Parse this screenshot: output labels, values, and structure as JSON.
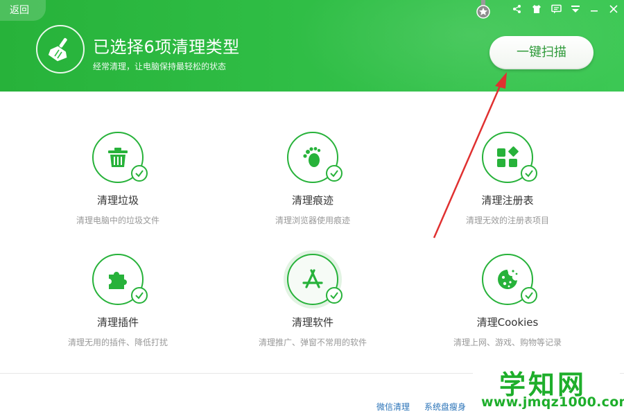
{
  "header": {
    "back_label": "返回",
    "title": "已选择6项清理类型",
    "subtitle": "经常清理，让电脑保持最轻松的状态",
    "scan_button": "一键扫描"
  },
  "titlebar": {
    "icons": [
      "medal-icon",
      "share-icon",
      "skin-icon",
      "message-icon",
      "menu-icon",
      "minimize-icon",
      "close-icon"
    ]
  },
  "items": [
    {
      "name": "清理垃圾",
      "desc": "清理电脑中的垃圾文件",
      "icon": "trash-icon",
      "checked": true
    },
    {
      "name": "清理痕迹",
      "desc": "清理浏览器使用痕迹",
      "icon": "footprint-icon",
      "checked": true
    },
    {
      "name": "清理注册表",
      "desc": "清理无效的注册表项目",
      "icon": "registry-icon",
      "checked": true
    },
    {
      "name": "清理插件",
      "desc": "清理无用的插件、降低打扰",
      "icon": "puzzle-icon",
      "checked": true
    },
    {
      "name": "清理软件",
      "desc": "清理推广、弹窗不常用的软件",
      "icon": "appstore-icon",
      "checked": true
    },
    {
      "name": "清理Cookies",
      "desc": "清理上网、游戏、购物等记录",
      "icon": "cookie-icon",
      "checked": true
    }
  ],
  "footer": {
    "links": [
      "微信清理",
      "系统盘瘦身"
    ]
  },
  "watermark": {
    "title": "学知网",
    "url": "www.jmqz1000.com"
  },
  "colors": {
    "brand_green": "#27b23a",
    "annotation_red": "#e03030",
    "link_blue": "#2a73b8"
  }
}
